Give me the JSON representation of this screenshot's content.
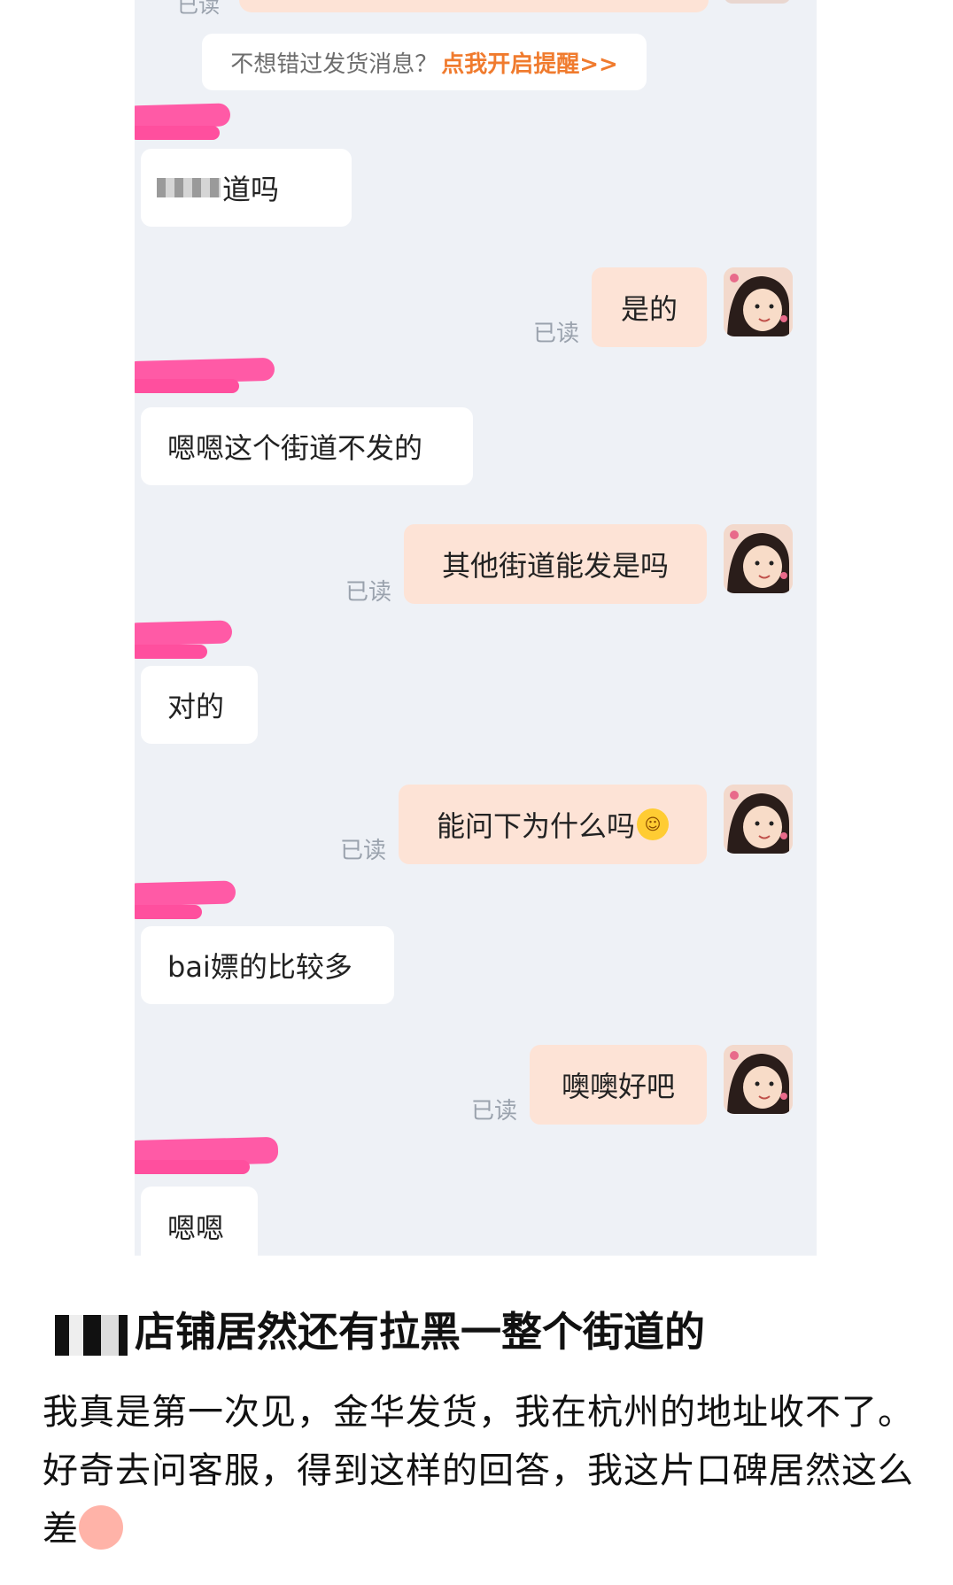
{
  "top_read_label": "已读",
  "notice": {
    "text": "不想错过发货消息？",
    "link": "点我开启提醒>>"
  },
  "messages": [
    {
      "side": "left",
      "text": "道吗"
    },
    {
      "side": "right",
      "text": "是的",
      "status": "已读"
    },
    {
      "side": "left",
      "text": "嗯嗯这个街道不发的"
    },
    {
      "side": "right",
      "text": "其他街道能发是吗",
      "status": "已读"
    },
    {
      "side": "left",
      "text": "对的"
    },
    {
      "side": "right",
      "text": "能问下为什么吗",
      "status": "已读"
    },
    {
      "side": "left",
      "text": "bai嫖的比较多"
    },
    {
      "side": "right",
      "text": "噢噢好吧",
      "status": "已读"
    },
    {
      "side": "left",
      "text": "嗯嗯"
    }
  ],
  "post": {
    "title": "店铺居然还有拉黑一整个街道的",
    "body": "我真是第一次见，金华发货，我在杭州的地址收不了。好奇去问客服，得到这样的回答，我这片口碑居然这么差"
  },
  "icons": {
    "avatar": "girl-avatar-icon",
    "laugh": "tears-of-joy-emoji-icon",
    "cry": "crying-face-emoji-icon"
  },
  "colors": {
    "chat_bg": "#eef1f6",
    "my_bubble": "#fde3d6",
    "their_bubble": "#ffffff",
    "notice_link": "#f07b2e",
    "redaction": "#ff5aa6"
  }
}
